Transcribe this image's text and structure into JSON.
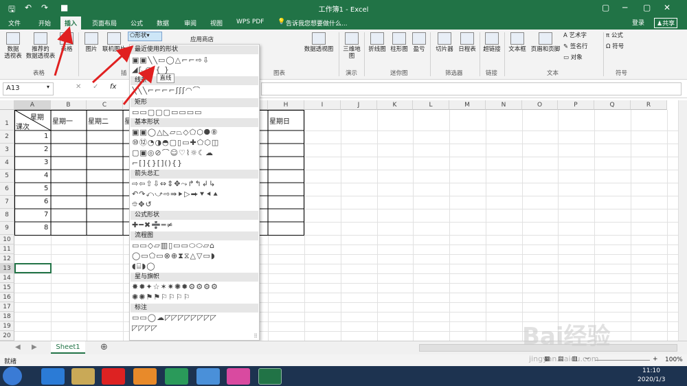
{
  "titlebar": {
    "title": "工作簿1 - Excel",
    "qa_icons": [
      "save-icon",
      "undo-icon",
      "redo-icon",
      "folder-icon"
    ],
    "win_buttons": [
      "▢",
      "─",
      "▢",
      "✕"
    ]
  },
  "menu": {
    "tabs": [
      "文件",
      "开始",
      "插入",
      "页面布局",
      "公式",
      "数据",
      "审阅",
      "视图",
      "WPS PDF"
    ],
    "active_index": 2,
    "tellme": "告诉我您想要做什么...",
    "login": "登录",
    "share": "共享"
  },
  "ribbon": {
    "buttons": [
      "数据\n透视表",
      "推荐的\n数据透视表",
      "表格",
      "图片",
      "联机图片",
      "形状",
      "应用商店",
      "数据透视图",
      "三维地\n图",
      "折线图",
      "柱形图",
      "盈亏",
      "切片器",
      "日程表",
      "超链接",
      "文本框",
      "页眉和页脚",
      "艺术字",
      "签名行",
      "对象",
      "公式",
      "符号"
    ],
    "groups": [
      "表格",
      "插",
      "图表",
      "演示",
      "迷你图",
      "筛选器",
      "链接",
      "文本",
      "符号"
    ]
  },
  "formula": {
    "namebox": "A13",
    "cancel": "✕",
    "enter": "✓",
    "fx": "fx"
  },
  "grid": {
    "columns": [
      "A",
      "B",
      "C",
      "D",
      "E",
      "F",
      "G",
      "H",
      "I",
      "J",
      "K",
      "L",
      "M",
      "N",
      "O",
      "P",
      "Q",
      "R"
    ],
    "rows": [
      "1",
      "2",
      "3",
      "4",
      "5",
      "6",
      "7",
      "8",
      "9",
      "10",
      "11",
      "12",
      "13",
      "14",
      "15",
      "16",
      "17",
      "18",
      "19",
      "20"
    ],
    "a1_top": "星期",
    "a1_bottom": "课次",
    "headers": [
      "星期一",
      "星期二",
      "星",
      "星期日"
    ],
    "lessons": [
      "1",
      "2",
      "3",
      "4",
      "5",
      "6",
      "7",
      "8"
    ]
  },
  "dropdown": {
    "button": "形状",
    "sections": [
      "最近使用的形状",
      "线条",
      "矩形",
      "基本形状",
      "箭头总汇",
      "公式形状",
      "流程图",
      "星与旗帜",
      "标注"
    ],
    "tooltip": "直线"
  },
  "tabs": {
    "sheet": "Sheet1",
    "add": "⊕"
  },
  "status": {
    "ready": "就绪",
    "zoom": "100%"
  },
  "tray": {
    "time": "11:10",
    "date": "2020/1/3"
  },
  "watermark": {
    "text": "Bai经验",
    "url": "jingyan.baidu.com"
  }
}
